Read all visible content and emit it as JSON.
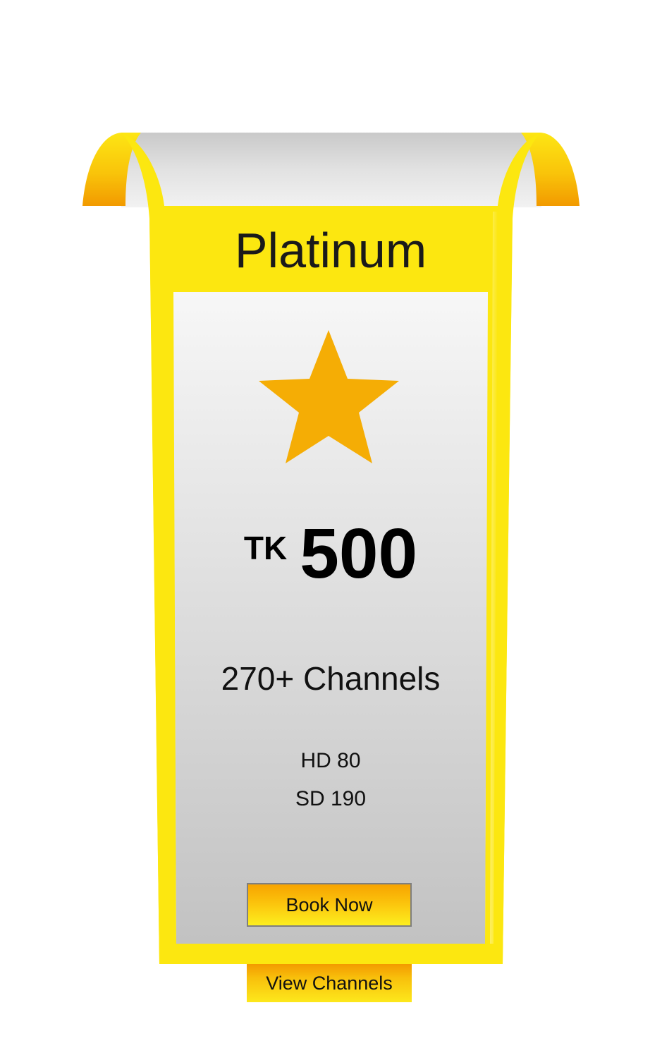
{
  "plan": {
    "title": "Platinum",
    "price_currency": "TK",
    "price_amount": "500",
    "channels_total": "270+ Channels",
    "hd": "HD 80",
    "sd": "SD 190"
  },
  "actions": {
    "book_label": "Book Now",
    "view_label": "View Channels"
  },
  "icons": {
    "plan_icon": "star-icon"
  },
  "colors": {
    "ribbon_yellow": "#fde810",
    "fold_orange": "#f59e00",
    "star_orange": "#f5ad05",
    "panel_gray_top": "#f6f6f6",
    "panel_gray_bottom": "#c4c4c4"
  }
}
